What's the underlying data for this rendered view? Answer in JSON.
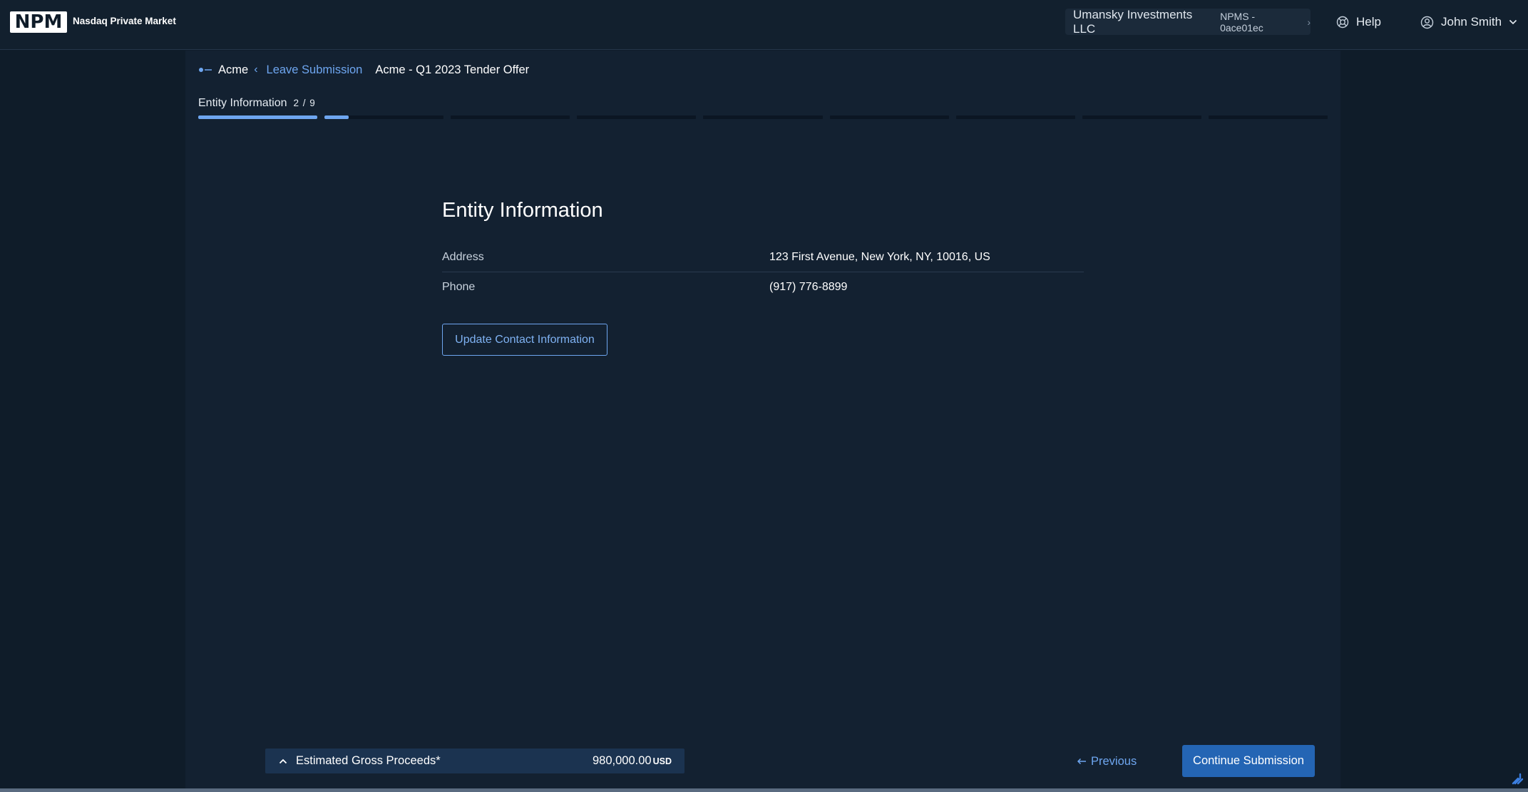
{
  "header": {
    "logo": "NPM",
    "brand_name": "Nasdaq Private Market",
    "account_name": "Umansky Investments LLC",
    "account_id": "NPMS - 0ace01ec",
    "help_label": "Help",
    "user_name": "John Smith"
  },
  "breadcrumb": {
    "company": "Acme",
    "leave_label": "Leave Submission",
    "title": "Acme - Q1 2023 Tender Offer"
  },
  "progress": {
    "step_label": "Entity Information",
    "step_count": "2 / 9",
    "current_step": 2,
    "total_steps": 9,
    "current_step_fill": 0.2
  },
  "content": {
    "heading": "Entity Information",
    "rows": [
      {
        "label": "Address",
        "value": "123 First Avenue, New York, NY, 10016, US"
      },
      {
        "label": "Phone",
        "value": "(917) 776-8899"
      }
    ],
    "update_button": "Update Contact Information"
  },
  "footer": {
    "proceeds_label": "Estimated Gross Proceeds*",
    "proceeds_value": "980,000.00",
    "proceeds_unit": "USD",
    "previous_label": "Previous",
    "continue_label": "Continue Submission"
  },
  "colors": {
    "accent": "#6ea6f0",
    "primary_button": "#2465b4",
    "background": "#0f1c29",
    "panel": "#132131"
  }
}
